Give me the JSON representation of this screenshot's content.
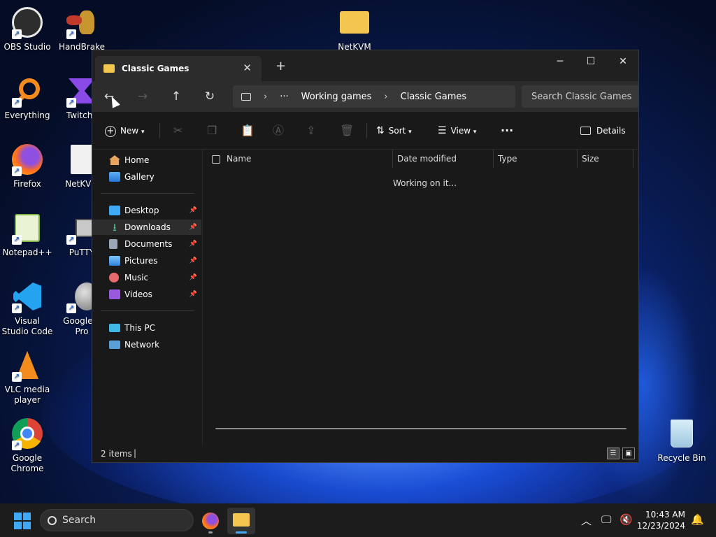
{
  "desktop": {
    "icons": [
      {
        "label": "OBS Studio"
      },
      {
        "label": "HandBrake"
      },
      {
        "label": "NetKVM"
      },
      {
        "label": "Everything"
      },
      {
        "label": "TwitchL"
      },
      {
        "label": "Firefox"
      },
      {
        "label": "NetKVM"
      },
      {
        "label": "Notepad++"
      },
      {
        "label": "PuTTY"
      },
      {
        "label": "Visual Studio Code"
      },
      {
        "label": "Google E Pro"
      },
      {
        "label": "VLC media player"
      },
      {
        "label": "Google Chrome"
      },
      {
        "label": "Recycle Bin"
      }
    ]
  },
  "explorer": {
    "tab_title": "Classic Games",
    "new_tab_symbol": "+",
    "breadcrumb": [
      "Working games",
      "Classic Games"
    ],
    "breadcrumb_more": "···",
    "search_placeholder": "Search Classic Games",
    "toolbar": {
      "new_label": "New",
      "sort_label": "Sort",
      "view_label": "View",
      "more_label": "···",
      "details_label": "Details"
    },
    "nav": {
      "quick": [
        "Home",
        "Gallery"
      ],
      "pinned": [
        "Desktop",
        "Downloads",
        "Documents",
        "Pictures",
        "Music",
        "Videos"
      ],
      "devices": [
        "This PC",
        "Network"
      ],
      "active": "Downloads"
    },
    "columns": [
      "Name",
      "Date modified",
      "Type",
      "Size"
    ],
    "loading_text": "Working on it...",
    "status": {
      "items": "2 items",
      "caret": "|"
    }
  },
  "taskbar": {
    "search_label": "Search",
    "time": "10:43 AM",
    "date": "12/23/2024"
  },
  "colors": {
    "folder": "#f3c64f",
    "accent": "#3fa9f5"
  }
}
